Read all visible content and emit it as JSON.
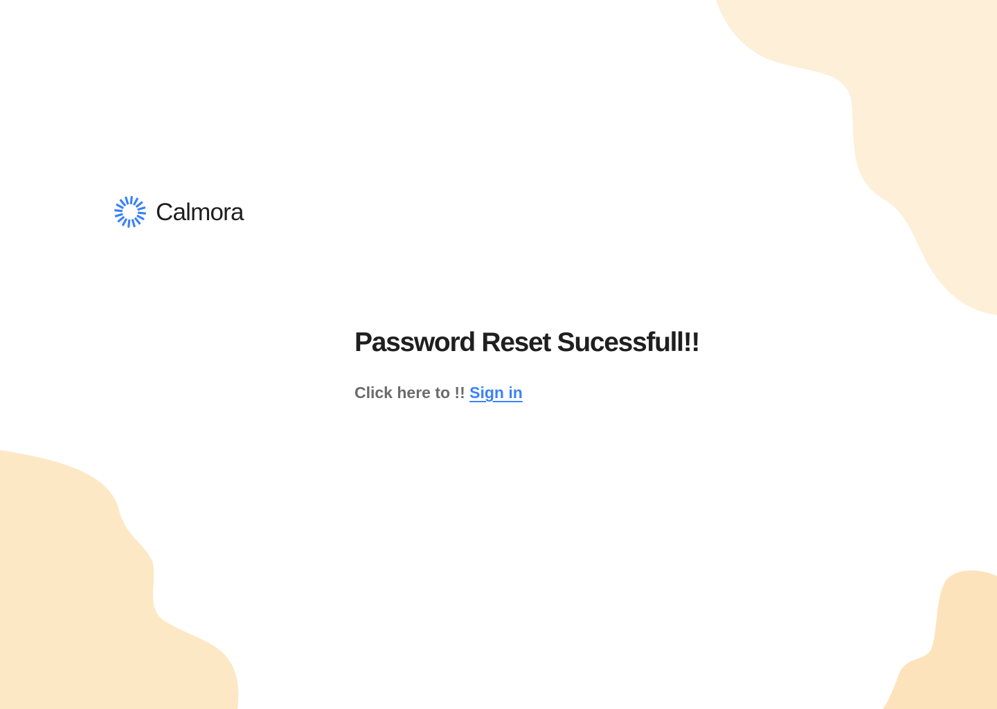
{
  "brand": {
    "name": "Calmora",
    "logo_icon": "sunburst-icon",
    "logo_color": "#3b82f6"
  },
  "message": {
    "title": "Password Reset Sucessfull!!",
    "prompt": "Click here to !!",
    "link_label": "Sign in"
  },
  "theme": {
    "blob_color": "#fdefd8",
    "title_color": "#1f1f1f",
    "prompt_color": "#6b6b6b",
    "link_color": "#3b82f6"
  }
}
